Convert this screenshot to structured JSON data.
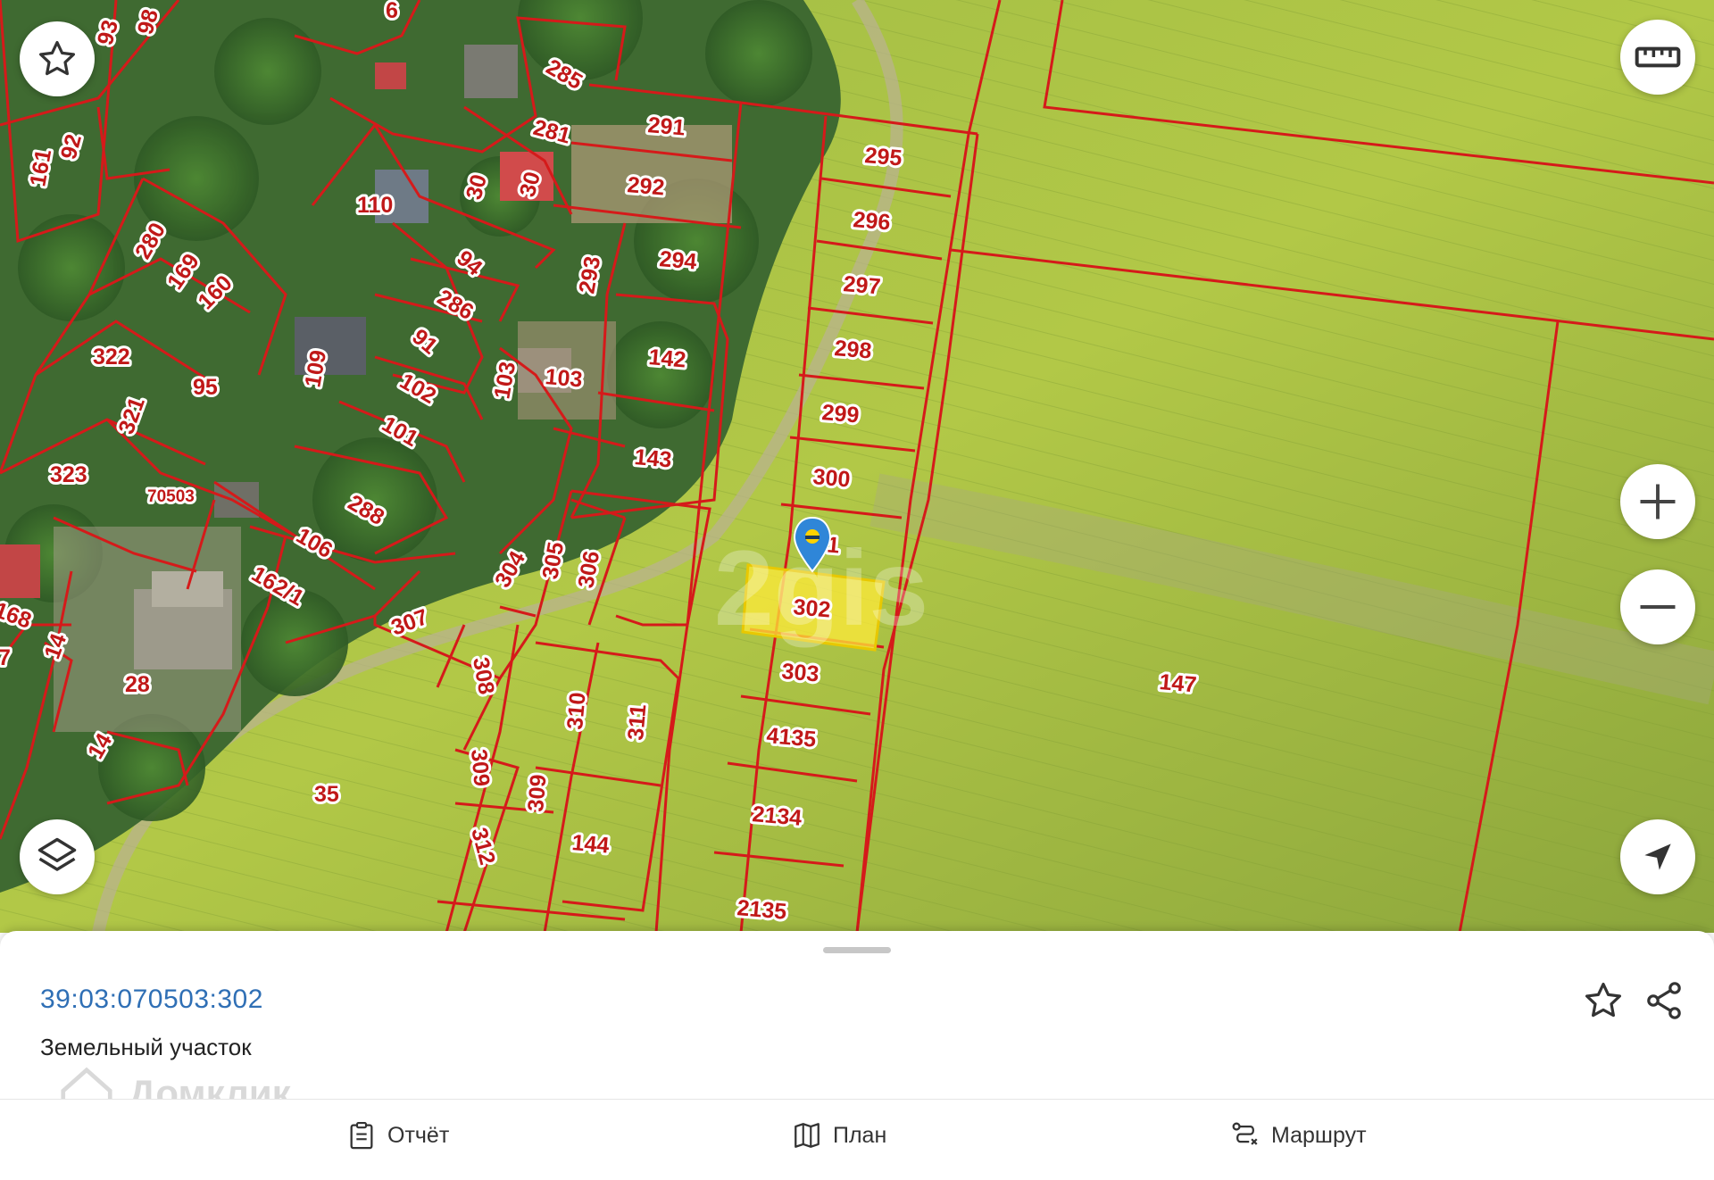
{
  "map": {
    "watermark": "2gis",
    "colors": {
      "boundary": "#d51a1a",
      "label_text": "#c01818",
      "selected_fill": "#ffea3a",
      "selected_stroke": "#e8c800",
      "marker": "#2f86d8",
      "field": "#8fae3f",
      "village": "#4d6b3a"
    },
    "labels": {
      "l_98": "98",
      "l_93": "93",
      "l_6": "6",
      "l_285": "285",
      "l_281": "281",
      "l_291": "291",
      "l_92": "92",
      "l_161": "161",
      "l_30a": "30",
      "l_30b": "30",
      "l_110": "110",
      "l_292": "292",
      "l_295": "295",
      "l_296": "296",
      "l_297": "297",
      "l_298": "298",
      "l_299": "299",
      "l_300": "300",
      "l_301": "301",
      "l_302": "302",
      "l_303": "303",
      "l_4135": "4135",
      "l_2134": "2134",
      "l_2135": "2135",
      "l_280": "280",
      "l_169": "169",
      "l_160": "160",
      "l_94": "94",
      "l_286": "286",
      "l_293": "293",
      "l_294": "294",
      "l_322": "322",
      "l_109": "109",
      "l_91": "91",
      "l_142": "142",
      "l_102": "102",
      "l_103a": "103",
      "l_103b": "103",
      "l_95": "95",
      "l_321": "321",
      "l_101": "101",
      "l_143": "143",
      "l_323": "323",
      "l_70503": "70503",
      "l_288": "288",
      "l_106": "106",
      "l_162_1": "162/1",
      "l_304": "304",
      "l_305": "305",
      "l_306": "306",
      "l_307": "307",
      "l_168": "168",
      "l_14a": "14",
      "l_7": "7",
      "l_28": "28",
      "l_308": "308",
      "l_310": "310",
      "l_311": "311",
      "l_14b": "14",
      "l_35": "35",
      "l_309a": "309",
      "l_309b": "309",
      "l_312": "312",
      "l_144": "144",
      "l_147": "147"
    },
    "controls": {
      "favorite": "star-icon",
      "ruler": "ruler-icon",
      "zoom_in": "plus-icon",
      "zoom_out": "minus-icon",
      "layers": "layers-icon",
      "locate": "navigation-arrow-icon"
    }
  },
  "sheet": {
    "cadastral_number": "39:03:070503:302",
    "parcel_type": "Земельный участок",
    "logo_text": "Домклик",
    "favorite_icon": "star-icon",
    "share_icon": "share-icon"
  },
  "actions": {
    "report": {
      "label": "Отчёт",
      "icon": "report-icon"
    },
    "plan": {
      "label": "План",
      "icon": "map-icon"
    },
    "route": {
      "label": "Маршрут",
      "icon": "route-icon"
    }
  }
}
